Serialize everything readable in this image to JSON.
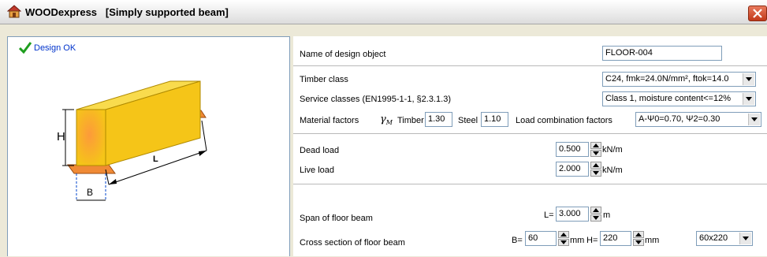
{
  "window": {
    "title": "WOODexpress   [Simply supported beam]",
    "close_icon": "close-icon",
    "app_icon": "house-icon"
  },
  "left": {
    "status_icon": "checkmark-icon",
    "status_text": "Design OK",
    "diagram": {
      "label_h": "H",
      "label_l": "L",
      "label_b": "B"
    }
  },
  "object": {
    "name_label": "Name of design object",
    "name_value": "FLOOR-004"
  },
  "timber": {
    "class_label": "Timber class",
    "class_value": "C24, fmk=24.0N/mm², ftok=14.0",
    "service_label": "Service classes (EN1995-1-1, §2.3.1.3)",
    "service_value": "Class 1, moisture content<=12%",
    "material_label": "Material factors",
    "gamma_symbol": "γ",
    "gamma_sub": "M",
    "timber_label": "Timber",
    "timber_value": "1.30",
    "steel_label": "Steel",
    "steel_value": "1.10",
    "loadcomb_label": "Load combination factors",
    "loadcomb_value": "A-Ψ0=0.70, Ψ2=0.30"
  },
  "loads": {
    "dead_label": "Dead load",
    "dead_value": "0.500",
    "dead_unit": "kN/m",
    "live_label": "Live load",
    "live_value": "2.000",
    "live_unit": "kN/m"
  },
  "geometry": {
    "span_label": "Span of floor beam",
    "span_prefix": "L=",
    "span_value": "3.000",
    "span_unit": "m",
    "cross_label": "Cross section of floor beam",
    "b_prefix": "B=",
    "b_value": "60",
    "b_unit": "mm",
    "h_prefix": "H=",
    "h_value": "220",
    "h_unit": "mm",
    "section_value": "60x220"
  },
  "colors": {
    "beam": "#f5c518",
    "beam_top": "#f9db4d",
    "support": "#f08a35",
    "status_text": "#0033cc"
  }
}
